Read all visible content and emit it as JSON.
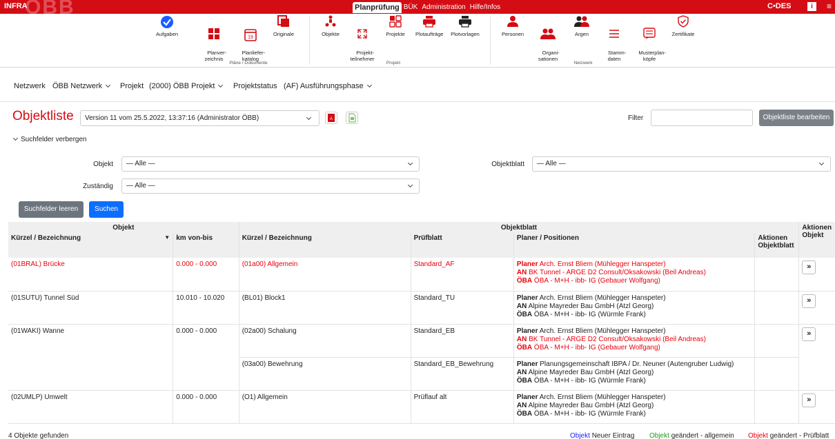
{
  "header": {
    "brand": "INFRA",
    "brand_watermark": "ÖBB",
    "tabs": [
      {
        "label": "Planprüfung",
        "active": true
      },
      {
        "label": "BÜK",
        "active": false
      },
      {
        "label": "Administration",
        "active": false
      },
      {
        "label": "Hilfe/Infos",
        "active": false
      }
    ],
    "codes_logo": "C•DES",
    "info_icon": "i",
    "accent_color": "#d40c14"
  },
  "toolbar": {
    "items": [
      {
        "label": "Aufgaben",
        "icon": "check-circle-icon"
      },
      {
        "label": "Planver-\nzeichnis",
        "icon": "grid-icon"
      },
      {
        "label": "Planliefer-\nkatalog",
        "icon": "calendar-icon",
        "badge": "19"
      },
      {
        "label": "Originale",
        "icon": "documents-icon"
      },
      {
        "label": "Objekte",
        "icon": "objects-icon"
      },
      {
        "label": "Projekt-\nteilnehmer",
        "icon": "expand-arrows-icon"
      },
      {
        "label": "Projekte",
        "icon": "projects-icon"
      },
      {
        "label": "Plotaufträge",
        "icon": "printer-icon"
      },
      {
        "label": "Plotvorlagen",
        "icon": "printer-dark-icon"
      },
      {
        "label": "Personen",
        "icon": "person-icon"
      },
      {
        "label": "Organi-\nsationen",
        "icon": "group-icon"
      },
      {
        "label": "Argen",
        "icon": "group-dark-icon"
      },
      {
        "label": "Stamm-\ndaten",
        "icon": "list-icon"
      },
      {
        "label": "Musterplan-\nköpfe",
        "icon": "form-icon"
      },
      {
        "label": "Zertifikate",
        "icon": "shield-check-icon"
      }
    ],
    "groups": {
      "plaene": "Pläne / Dokumente",
      "projekt": "Projekt",
      "netzwerk": "Netzwerk"
    }
  },
  "context": {
    "netzwerk_label": "Netzwerk",
    "netzwerk_value": "ÖBB Netzwerk",
    "projekt_label": "Projekt",
    "projekt_value": "(2000) ÖBB Projekt",
    "status_label": "Projektstatus",
    "status_value": "(AF) Ausführungsphase"
  },
  "objektliste": {
    "title": "Objektliste",
    "version": "Version 11 vom 25.5.2022, 13:37:16 (Administrator ÖBB)",
    "filter_label": "Filter",
    "filter_value": "",
    "edit_button": "Objektliste bearbeiten"
  },
  "search": {
    "toggle": "Suchfelder verbergen",
    "objekt_label": "Objekt",
    "objekt_value": "— Alle —",
    "objektblatt_label": "Objektblatt",
    "objektblatt_value": "— Alle —",
    "zustaendig_label": "Zuständig",
    "zustaendig_value": "— Alle —",
    "clear_button": "Suchfelder leeren",
    "search_button": "Suchen"
  },
  "table": {
    "group_objekt": "Objekt",
    "group_objektblatt": "Objektblatt",
    "group_aktionen": "Aktionen\nObjekt",
    "col_kuerzel": "Kürzel / Bezeichnung",
    "col_km": "km von-bis",
    "col_blatt_kuerzel": "Kürzel / Bezeichnung",
    "col_pruefblatt": "Prüfblatt",
    "col_planer": "Planer / Positionen",
    "col_aktionen_blatt": "Aktionen\nObjektblatt"
  },
  "rows": [
    {
      "objekt": "(01BRAL) Brücke",
      "km": "0.000 - 0.000",
      "blatt": "(01a00) Allgemein",
      "pruefblatt": "Standard_AF",
      "planer": "Arch. Ernst Bliem (Mühlegger Hanspeter)",
      "an": "BK Tunnel - ARGE D2 Consult/Oksakowski (Beil Andreas)",
      "oeba": "ÖBA - M+H - ibb- IG (Gebauer Wolfgang)"
    },
    {
      "objekt": "(01SUTU) Tunnel Süd",
      "km": "10.010 - 10.020",
      "blatt": "(BL01) Block1",
      "pruefblatt": "Standard_TU",
      "planer": "Arch. Ernst Bliem (Mühlegger Hanspeter)",
      "an": "Alpine Mayreder Bau GmbH (Atzl Georg)",
      "oeba": "ÖBA - M+H - ibb- IG (Würmle Frank)"
    },
    {
      "objekt": "(01WAKI) Wanne",
      "km": "0.000 - 0.000",
      "blatt": "(02a00) Schalung",
      "pruefblatt": "Standard_EB",
      "planer": "Arch. Ernst Bliem (Mühlegger Hanspeter)",
      "an": "BK Tunnel - ARGE D2 Consult/Oksakowski (Beil Andreas)",
      "oeba": "ÖBA - M+H - ibb- IG (Gebauer Wolfgang)"
    },
    {
      "blatt": "(03a00) Bewehrung",
      "pruefblatt": "Standard_EB_Bewehrung",
      "planer": "Planungsgemeinschaft IBPA / Dr. Neuner (Autengruber Ludwig)",
      "an": "Alpine Mayreder Bau GmbH (Atzl Georg)",
      "oeba": "ÖBA - M+H - ibb- IG (Würmle Frank)"
    },
    {
      "objekt": "(02UMLP) Umwelt",
      "km": "0.000 - 0.000",
      "blatt": "(O1) Allgemein",
      "pruefblatt": "Prüflauf alt",
      "planer": "Arch. Ernst Bliem (Mühlegger Hanspeter)",
      "an": "Alpine Mayreder Bau GmbH (Atzl Georg)",
      "oeba": "ÖBA - M+H - ibb- IG (Würmle Frank)"
    }
  ],
  "roles": {
    "planer": "Planer",
    "an": "AN",
    "oeba": "ÖBA"
  },
  "action_glyph": "»",
  "footer": {
    "count": "4 Objekte gefunden",
    "legend": [
      {
        "key": "Objekt",
        "text": "Neuer Eintrag",
        "color": "#1a1aff"
      },
      {
        "key": "Objekt",
        "text": "geändert - allgemein",
        "color": "#1a9a1a"
      },
      {
        "key": "Objekt",
        "text": "geändert - Prüfblatt",
        "color": "#e8000d"
      }
    ]
  }
}
